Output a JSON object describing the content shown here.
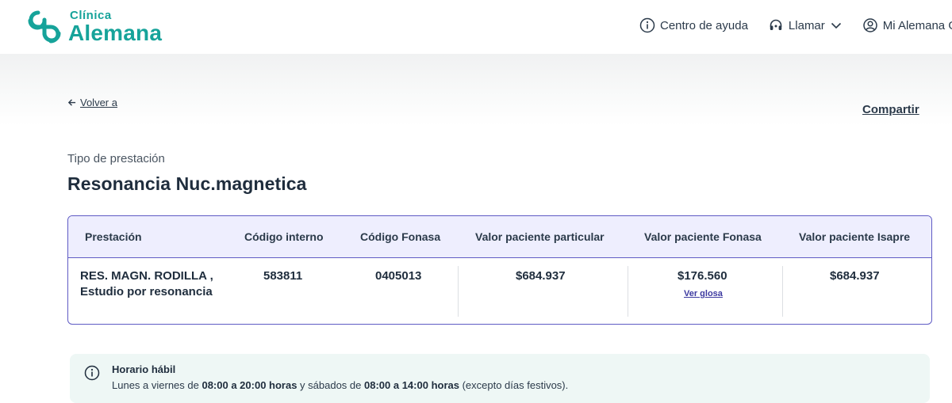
{
  "header": {
    "logo_small": "Clínica",
    "logo_big": "Alemana",
    "nav": {
      "help": "Centro de ayuda",
      "call": "Llamar",
      "account": "Mi Alemana Go"
    }
  },
  "page": {
    "back_label": "Volver a",
    "share_label": "Compartir",
    "subtitle": "Tipo de prestación",
    "title": "Resonancia Nuc.magnetica"
  },
  "table": {
    "headers": {
      "prestacion": "Prestación",
      "codigo_interno": "Código interno",
      "codigo_fonasa": "Código Fonasa",
      "valor_particular": "Valor paciente particular",
      "valor_fonasa": "Valor paciente Fonasa",
      "valor_isapre": "Valor paciente Isapre"
    },
    "row": {
      "prestacion": "RES. MAGN. RODILLA , Estudio por resonancia",
      "codigo_interno": "583811",
      "codigo_fonasa": "0405013",
      "valor_particular": "$684.937",
      "valor_fonasa": "$176.560",
      "valor_isapre": "$684.937",
      "glosa_label": "Ver glosa"
    }
  },
  "info": {
    "title": "Horario hábil",
    "text_1": "Lunes a viernes de ",
    "hours_1": "08:00 a 20:00 horas",
    "text_2": " y sábados de ",
    "hours_2": "08:00 a 14:00 horas",
    "text_3": " (excepto días festivos)."
  },
  "colors": {
    "brand": "#16a39a",
    "table_border": "#5f5bc4",
    "table_header_bg": "#eeeefe",
    "info_bg": "#eef7f5"
  }
}
